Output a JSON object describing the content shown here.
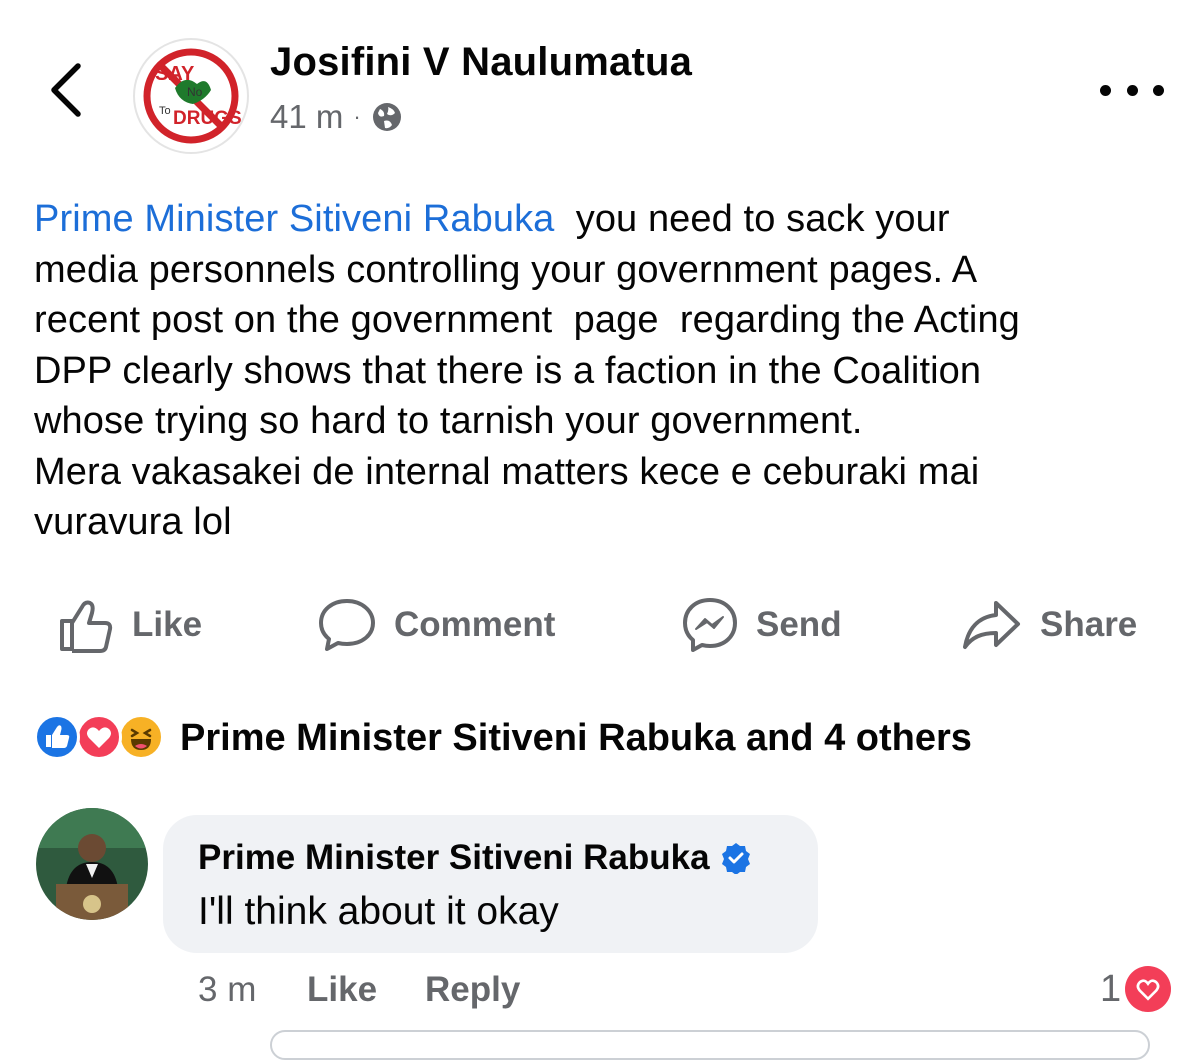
{
  "header": {
    "back_icon": "chevron-left-icon",
    "avatar_logo_text": "SAY NO TO DRUGS",
    "author": "Josifini V Naulumatua",
    "time": "41 m",
    "separator": "·",
    "audience_icon": "globe-icon",
    "more_icon": "more-horizontal-icon"
  },
  "post": {
    "mention": "Prime Minister Sitiveni Rabuka",
    "body": "  you need to sack your\nmedia personnels controlling your government pages. A\nrecent post on the government  page  regarding the Acting\nDPP clearly shows that there is a faction in the Coalition\nwhose trying so hard to tarnish your government.\nMera vakasakei de internal matters kece e ceburaki mai\nvuravura lol"
  },
  "actions": [
    {
      "label": "Like",
      "icon": "thumbs-up-icon"
    },
    {
      "label": "Comment",
      "icon": "comment-icon"
    },
    {
      "label": "Send",
      "icon": "messenger-icon"
    },
    {
      "label": "Share",
      "icon": "share-arrow-icon"
    }
  ],
  "reactions": {
    "icons": [
      "like-reaction-icon",
      "love-reaction-icon",
      "haha-reaction-icon"
    ],
    "summary": "Prime Minister Sitiveni Rabuka and 4 others"
  },
  "comment": {
    "author": "Prime Minister Sitiveni Rabuka",
    "verified": true,
    "text": "I'll think about it okay",
    "time": "3 m",
    "like_label": "Like",
    "reply_label": "Reply",
    "reaction_count": "1",
    "reaction_icon": "love-reaction-icon"
  },
  "colors": {
    "mention": "#1c6ed8",
    "secondary_text": "#65676b",
    "like_blue": "#1b74e4",
    "love_red": "#f33e58",
    "haha_yellow": "#f7b125",
    "bubble_bg": "#f0f2f5"
  }
}
